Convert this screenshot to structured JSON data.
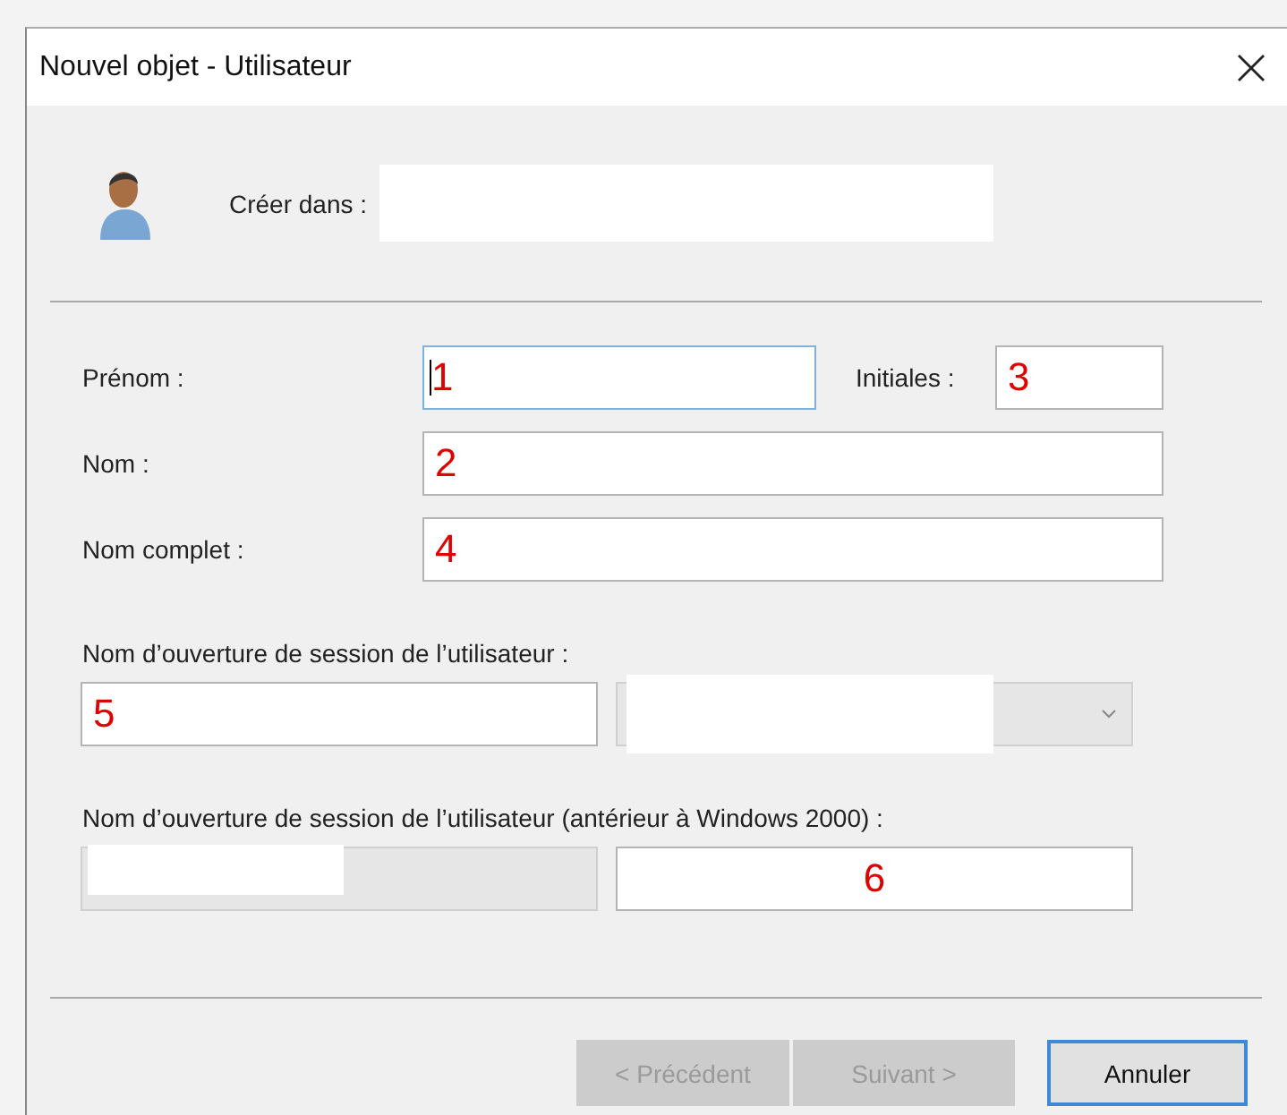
{
  "window": {
    "title": "Nouvel objet - Utilisateur"
  },
  "create_in": {
    "label": "Créer dans :"
  },
  "name_fields": [
    {
      "label": "Prénom :",
      "value": "1",
      "focused": true,
      "kind": "wide"
    },
    {
      "label": "Initiales :",
      "value": "3",
      "focused": false,
      "kind": "short"
    },
    {
      "label": "Nom :",
      "value": "2",
      "focused": false,
      "kind": "full"
    },
    {
      "label": "Nom complet :",
      "value": "4",
      "focused": false,
      "kind": "full"
    }
  ],
  "logon": {
    "label": "Nom d’ouverture de session de l’utilisateur :",
    "value": "5",
    "domain_disabled": true
  },
  "logon_legacy": {
    "label": "Nom d’ouverture de session de l’utilisateur (antérieur à Windows 2000) :",
    "domain_disabled": true,
    "value": "6"
  },
  "buttons": [
    {
      "label": "< Précédent",
      "disabled": true,
      "default": false
    },
    {
      "label": "Suivant >",
      "disabled": true,
      "default": false
    },
    {
      "label": "Annuler",
      "disabled": false,
      "default": true
    }
  ]
}
